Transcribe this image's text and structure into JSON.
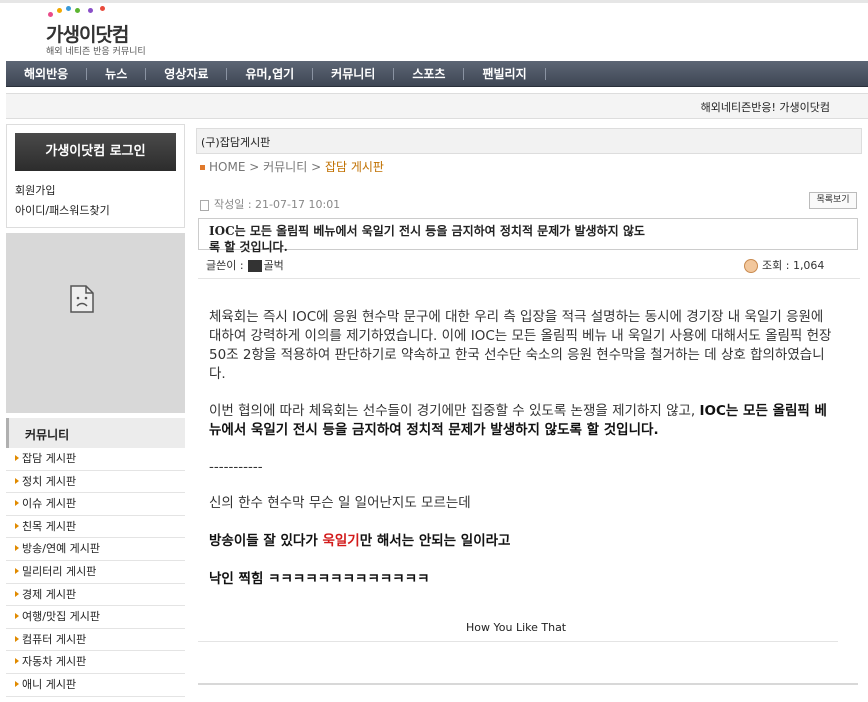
{
  "site": {
    "logo_title": "가생이닷컴",
    "logo_subtitle": "해외 네티즌 반응 커뮤니티",
    "dot_colors": [
      "#e94b8a",
      "#f2a900",
      "#3b9ad9",
      "#5cb531",
      "#8a4fc8",
      "#e94b3c"
    ]
  },
  "nav": {
    "items": [
      "해외반응",
      "뉴스",
      "영상자료",
      "유머,엽기",
      "커뮤니티",
      "스포츠",
      "팬빌리지"
    ]
  },
  "infobar": {
    "text": "해외네티즌반응! 가생이닷컴"
  },
  "sidebar": {
    "login_label": "가생이닷컴 로그인",
    "join_label": "회원가입",
    "find_label": "아이디/패스워드찾기",
    "category_title": "커뮤니티",
    "categories": [
      "잡담 게시판",
      "정치 게시판",
      "이슈 게시판",
      "친목 게시판",
      "방송/연예 게시판",
      "밀리터리 게시판",
      "경제 게시판",
      "여행/맛집 게시판",
      "컴퓨터 게시판",
      "자동차 게시판",
      "애니 게시판"
    ]
  },
  "board": {
    "title": "(구)잡담게시판",
    "breadcrumb_home": "HOME",
    "breadcrumb_sep": " > ",
    "breadcrumb_mid": "커뮤니티",
    "breadcrumb_current": "잡담 게시판",
    "date": "작성일 : 21-07-17 10:01",
    "list_button": "목록보기",
    "subject": "IOC는 모든 올림픽 베뉴에서 욱일기 전시 등을 금지하여 정치적 문제가 발생하지 않도록 할 것입니다.",
    "author_label": "글쓴이 :",
    "author_name": "골벅",
    "views": "조회 : 1,064"
  },
  "content": {
    "p1": "체육회는 즉시 IOC에 응원 현수막 문구에 대한 우리 측 입장을 적극 설명하는 동시에 경기장 내 욱일기 응원에 대하여 강력하게 이의를 제기하였습니다. 이에 IOC는 모든 올림픽 베뉴 내 욱일기 사용에 대해서도 올림픽 헌장 50조 2항을 적용하여 판단하기로 약속하고 한국 선수단 숙소의 응원 현수막을 철거하는 데 상호 합의하였습니다.",
    "p2_normal": "이번 협의에 따라 체육회는 선수들이 경기에만 집중할 수 있도록 논쟁을 제기하지 않고, ",
    "p2_bold": "IOC는 모든 올림픽 베뉴에서 욱일기 전시 등을 금지하여 정치적 문제가 발생하지 않도록 할 것입니다.",
    "divider": "-----------",
    "p4": "신의 한수 현수막 무슨 일 일어난지도 모르는데",
    "p5_a": "방송이들 잘 있다가 ",
    "p5_red": "욱일기",
    "p5_b": "만 해서는 안되는 일이라고",
    "p6": "낙인 찍힘 ㅋㅋㅋㅋㅋㅋㅋㅋㅋㅋㅋㅋㅋ",
    "signature": "How You Like That"
  }
}
